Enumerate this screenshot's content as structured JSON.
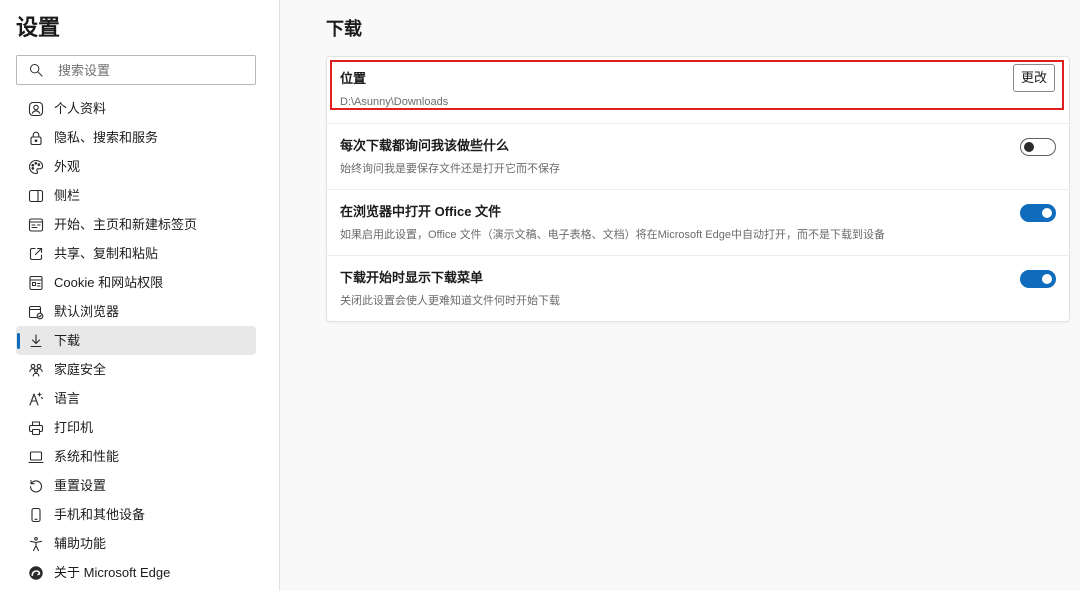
{
  "sidebar": {
    "title": "设置",
    "items": [
      {
        "label": "个人资料",
        "icon": "profile-icon",
        "selected": false
      },
      {
        "label": "隐私、搜索和服务",
        "icon": "lock-icon",
        "selected": false
      },
      {
        "label": "外观",
        "icon": "palette-icon",
        "selected": false
      },
      {
        "label": "侧栏",
        "icon": "sidebar-icon",
        "selected": false
      },
      {
        "label": "开始、主页和新建标签页",
        "icon": "start-page-icon",
        "selected": false
      },
      {
        "label": "共享、复制和粘贴",
        "icon": "share-icon",
        "selected": false
      },
      {
        "label": "Cookie 和网站权限",
        "icon": "site-permissions-icon",
        "selected": false
      },
      {
        "label": "默认浏览器",
        "icon": "default-browser-icon",
        "selected": false
      },
      {
        "label": "下载",
        "icon": "download-icon",
        "selected": true
      },
      {
        "label": "家庭安全",
        "icon": "family-icon",
        "selected": false
      },
      {
        "label": "语言",
        "icon": "language-icon",
        "selected": false
      },
      {
        "label": "打印机",
        "icon": "printer-icon",
        "selected": false
      },
      {
        "label": "系统和性能",
        "icon": "laptop-icon",
        "selected": false
      },
      {
        "label": "重置设置",
        "icon": "reset-icon",
        "selected": false
      },
      {
        "label": "手机和其他设备",
        "icon": "phone-icon",
        "selected": false
      },
      {
        "label": "辅助功能",
        "icon": "accessibility-icon",
        "selected": false
      },
      {
        "label": "关于 Microsoft Edge",
        "icon": "edge-logo-icon",
        "selected": false
      }
    ]
  },
  "search": {
    "placeholder": "搜索设置",
    "icon": "search-icon"
  },
  "main": {
    "title": "下载",
    "location": {
      "title": "位置",
      "path": "D:\\Asunny\\Downloads",
      "change_label": "更改"
    },
    "toggles": [
      {
        "title": "每次下载都询问我该做些什么",
        "description": "始终询问我是要保存文件还是打开它而不保存",
        "enabled": false
      },
      {
        "title": "在浏览器中打开 Office 文件",
        "description": "如果启用此设置，Office 文件（演示文稿、电子表格、文档）将在Microsoft Edge中自动打开，而不是下载到设备",
        "enabled": true
      },
      {
        "title": "下载开始时显示下载菜单",
        "description": "关闭此设置会使人更难知道文件何时开始下载",
        "enabled": true
      }
    ]
  },
  "colors": {
    "accent": "#0f6cbd",
    "highlight": "#e02020",
    "selected_bg": "#e8e8e8"
  }
}
